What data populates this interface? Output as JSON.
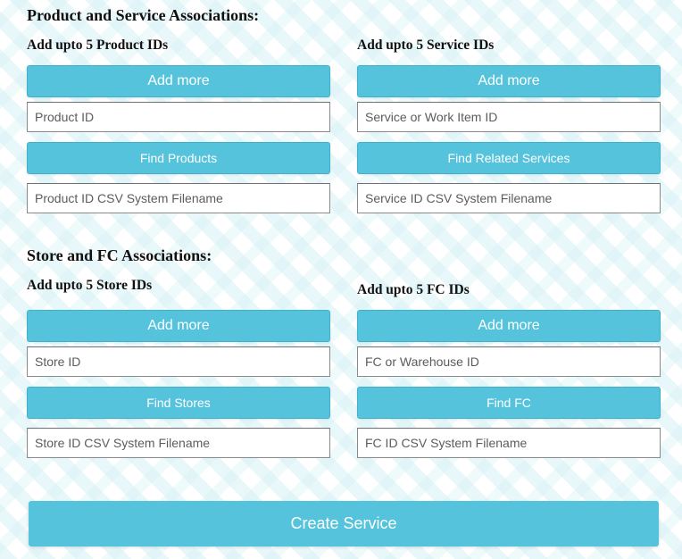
{
  "product_service": {
    "title": "Product and Service Associations:",
    "product": {
      "heading": "Add upto 5 Product IDs",
      "add_more_label": "Add more",
      "id_placeholder": "Product ID",
      "find_label": "Find Products",
      "csv_placeholder": "Product ID CSV System Filename"
    },
    "service": {
      "heading": "Add upto 5 Service IDs",
      "add_more_label": "Add more",
      "id_placeholder": "Service or Work Item ID",
      "find_label": "Find Related Services",
      "csv_placeholder": "Service ID CSV System Filename"
    }
  },
  "store_fc": {
    "title": "Store and FC Associations:",
    "store": {
      "heading": "Add upto 5 Store IDs",
      "add_more_label": "Add more",
      "id_placeholder": "Store ID",
      "find_label": "Find Stores",
      "csv_placeholder": "Store ID CSV System Filename"
    },
    "fc": {
      "heading": "Add upto 5 FC IDs",
      "add_more_label": "Add more",
      "id_placeholder": "FC or Warehouse ID",
      "find_label": "Find FC",
      "csv_placeholder": "FC ID CSV System Filename"
    }
  },
  "create_button_label": "Create Service",
  "colors": {
    "accent": "#55c3db",
    "button_text": "#ffffff",
    "pattern": "#d6f0f4"
  }
}
